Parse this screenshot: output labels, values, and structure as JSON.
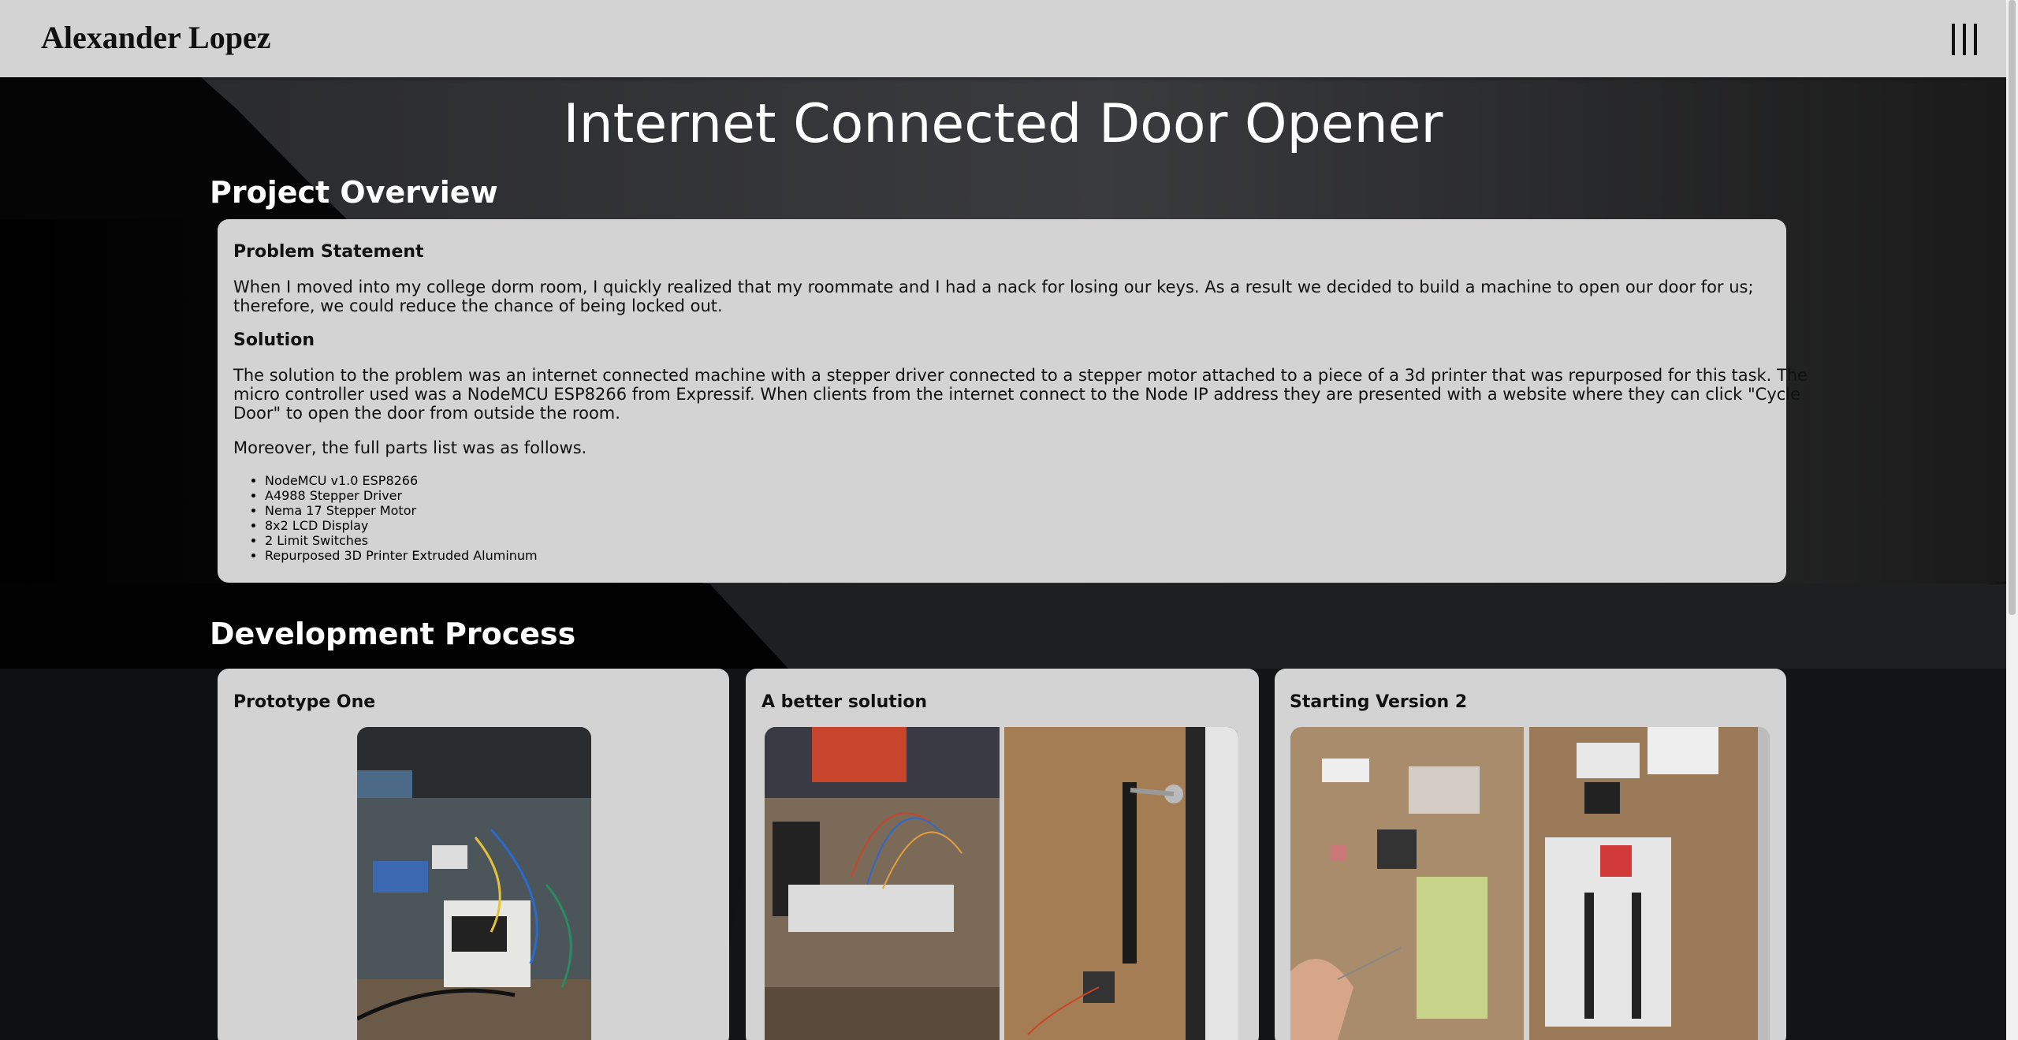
{
  "header": {
    "site_title": "Alexander Lopez",
    "menu_icon": "hamburger-icon"
  },
  "page_title": "Internet Connected Door Opener",
  "overview": {
    "section_title": "Project Overview",
    "problem_heading": "Problem Statement",
    "problem_line1": "When I moved into my college dorm room, I quickly realized that my roommate and I had a nack for losing our keys. As a result we decided to build a machine to open our door for us;",
    "problem_line2": "therefore, we could reduce the chance of being locked out.",
    "solution_heading": "Solution",
    "solution_line1": "The solution to the problem was an internet connected machine with a stepper driver connected to a stepper motor attached to a piece of a 3d printer that was repurposed for this task. The",
    "solution_line2": "micro controller used was a NodeMCU ESP8266 from Expressif. When clients from the internet connect to the Node IP address they are presented with a website where they can click \"Cycle",
    "solution_line3": "Door\" to open the door from outside the room.",
    "parts_intro": "Moreover, the full parts list was as follows.",
    "parts": [
      "NodeMCU v1.0 ESP8266",
      "A4988 Stepper Driver",
      "Nema 17 Stepper Motor",
      "8x2 LCD Display",
      "2 Limit Switches",
      "Repurposed 3D Printer Extruded Aluminum"
    ]
  },
  "development": {
    "section_title": "Development Process",
    "cards": [
      {
        "title": "Prototype One"
      },
      {
        "title": "A better solution"
      },
      {
        "title": "Starting Version 2"
      }
    ]
  },
  "colors": {
    "header_bg": "#d3d3d3",
    "card_bg": "#d3d3d3",
    "page_bg": "#0b0b0b",
    "text_light": "#ffffff"
  }
}
